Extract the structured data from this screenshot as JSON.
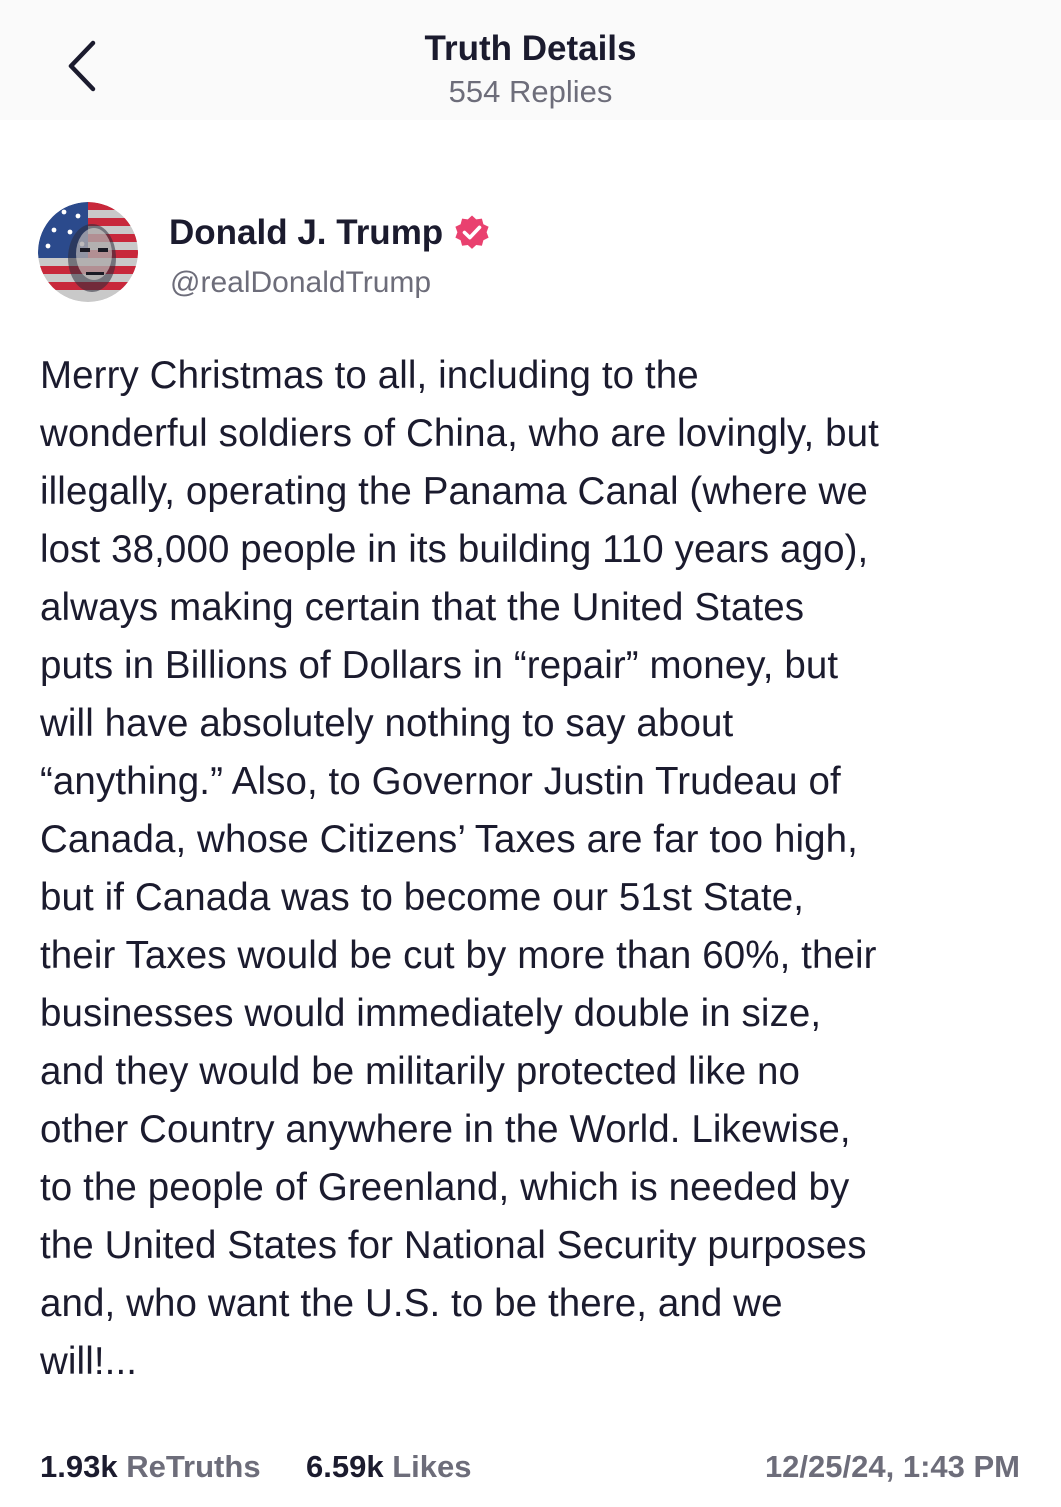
{
  "header": {
    "title": "Truth Details",
    "subtitle": "554 Replies",
    "back_icon": "chevron-left-icon"
  },
  "author": {
    "name": "Donald J. Trump",
    "handle": "@realDonaldTrump",
    "verified": true,
    "verified_color": "#e9416f"
  },
  "post": {
    "text": "Merry Christmas to all, including to the\nwonderful soldiers of China, who are lovingly, but\nillegally, operating the Panama Canal (where we\nlost 38,000 people in its building 110 years ago),\nalways making certain that the United States\nputs in Billions of Dollars in “repair” money, but\nwill have absolutely nothing to say about\n“anything.” Also, to Governor Justin Trudeau of\nCanada, whose Citizens’ Taxes are far too high,\nbut if Canada was to become our 51st State,\ntheir Taxes would be cut by more than 60%, their\nbusinesses would immediately double in size,\nand they would be militarily protected like no\nother Country anywhere in the World. Likewise,\nto the people of Greenland, which is needed by\nthe United States for National Security purposes\nand, who want the U.S. to be there, and we\nwill!..."
  },
  "stats": {
    "retruths_count": "1.93k",
    "retruths_label": "ReTruths",
    "likes_count": "6.59k",
    "likes_label": "Likes",
    "timestamp": "12/25/24, 1:43 PM"
  }
}
